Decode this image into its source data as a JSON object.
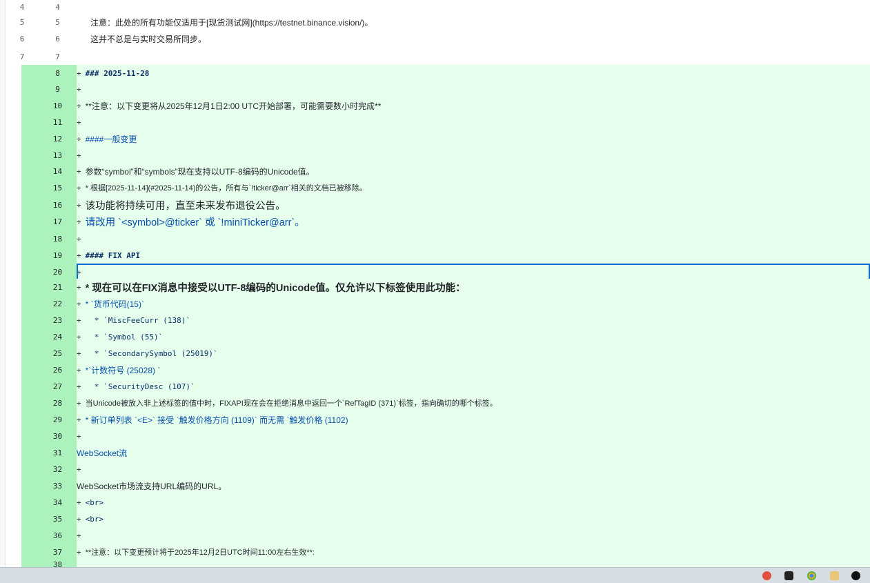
{
  "lines": [
    {
      "o": "4",
      "n": "4",
      "type": "ctx",
      "text": ""
    },
    {
      "o": "5",
      "n": "5",
      "type": "ctx",
      "text": "注意：此处的所有功能仅适用于[现货测试网](https://testnet.binance.vision/)。"
    },
    {
      "o": "6",
      "n": "6",
      "type": "ctx",
      "text": "这并不总是与实时交易所同步。"
    },
    {
      "o": "7",
      "n": "7",
      "type": "ctx",
      "text": ""
    },
    {
      "n": "8",
      "type": "add",
      "text": "### 2025-11-28",
      "style": "mono bold"
    },
    {
      "n": "9",
      "type": "add",
      "text": ""
    },
    {
      "n": "10",
      "type": "add",
      "text": "**注意：以下变更将从2025年12月1日2:00 UTC开始部署，可能需要数小时完成**",
      "style": "sans"
    },
    {
      "n": "11",
      "type": "add",
      "text": ""
    },
    {
      "n": "12",
      "type": "add",
      "text": "####一般变更",
      "style": "sans blue"
    },
    {
      "n": "13",
      "type": "add",
      "text": ""
    },
    {
      "n": "14",
      "type": "add",
      "text": "参数“symbol”和“symbols”现在支持以UTF-8编码的Unicode值。",
      "style": "sans"
    },
    {
      "n": "15",
      "type": "add",
      "text": "* 根据[2025-11-14](#2025-11-14)的公告，所有与`!ticker@arr`相关的文档已被移除。",
      "style": "sans small"
    },
    {
      "n": "16",
      "type": "add",
      "text": "该功能将持续可用，直至未来发布退役公告。",
      "style": "big"
    },
    {
      "n": "17",
      "type": "add",
      "text": "请改用 `<symbol>@ticker` 或 `!miniTicker@arr`。",
      "style": "big blue"
    },
    {
      "n": "18",
      "type": "add",
      "text": ""
    },
    {
      "n": "19",
      "type": "add",
      "text": "#### FIX API",
      "style": "mono bold"
    },
    {
      "n": "20",
      "type": "add",
      "text": "",
      "sel": true
    },
    {
      "n": "21",
      "type": "add",
      "text": "* 现在可以在FIX消息中接受以UTF-8编码的Unicode值。仅允许以下标签使用此功能：",
      "style": "big bold"
    },
    {
      "n": "22",
      "type": "add",
      "text": "* `货币代码(15)`",
      "style": "sans blue"
    },
    {
      "n": "23",
      "type": "add",
      "text": "  * `MiscFeeCurr (138)`",
      "style": "mono"
    },
    {
      "n": "24",
      "type": "add",
      "text": "  * `Symbol (55)`",
      "style": "mono"
    },
    {
      "n": "25",
      "type": "add",
      "text": "  * `SecondarySymbol (25019)`",
      "style": "mono"
    },
    {
      "n": "26",
      "type": "add",
      "text": "*`计数符号 (25028) `",
      "style": "sans blue"
    },
    {
      "n": "27",
      "type": "add",
      "text": "  * `SecurityDesc (107)`",
      "style": "mono"
    },
    {
      "n": "28",
      "type": "add",
      "text": "当Unicode被放入非上述标签的值中时，FIXAPI现在会在拒绝消息中返回一个`RefTagID (371)`标签，指向确切的哪个标签。",
      "style": "sans small"
    },
    {
      "n": "29",
      "type": "add",
      "text": "* 新订单列表 `<E>` 接受 `触发价格方向 (1109)` 而无需 `触发价格 (1102)",
      "style": "sans blue"
    },
    {
      "n": "30",
      "type": "add",
      "text": ""
    },
    {
      "n": "31",
      "type": "add",
      "text": "WebSocket流",
      "style": "sans blue",
      "noplus": true
    },
    {
      "n": "32",
      "type": "add",
      "text": ""
    },
    {
      "n": "33",
      "type": "add",
      "text": "WebSocket市场流支持URL编码的URL。",
      "style": "sans",
      "noplus": true
    },
    {
      "n": "34",
      "type": "add",
      "text": "<br>",
      "style": "mono"
    },
    {
      "n": "35",
      "type": "add",
      "text": "<br>",
      "style": "mono"
    },
    {
      "n": "36",
      "type": "add",
      "text": ""
    },
    {
      "n": "37",
      "type": "add",
      "text": "**注意：以下变更预计将于2025年12月2日UTC时间11:00左右生效**:",
      "style": "sans small"
    },
    {
      "n": "38",
      "type": "add",
      "text": "",
      "partial": true
    }
  ],
  "colors": {
    "add_bg": "#e6ffec",
    "add_num": "#acf2bd",
    "select": "#0969da"
  },
  "tray_icons": [
    "record-icon",
    "terminal-icon",
    "chrome-icon",
    "folder-icon",
    "info-icon"
  ]
}
